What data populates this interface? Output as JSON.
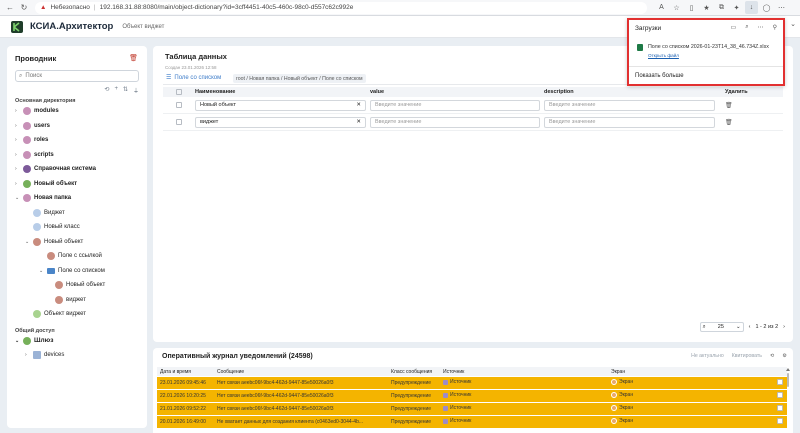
{
  "browser": {
    "security_label": "Небезопасно",
    "url": "192.168.31.88:8080/main/object-dictionary?id=3cff4451-40c5-460c-98c0-d557c62c992e"
  },
  "app": {
    "title": "КСИА.Архитектор",
    "subtitle": "Объект виджет",
    "accent": "#3d7cc9"
  },
  "explorer": {
    "title": "Проводник",
    "search_placeholder": "Поиск",
    "main_section": "Основная директория",
    "shared_section": "Общий доступ",
    "items": [
      {
        "label": "modules",
        "bold": true
      },
      {
        "label": "users",
        "bold": true
      },
      {
        "label": "roles",
        "bold": true
      },
      {
        "label": "scripts",
        "bold": true
      },
      {
        "label": "Справочная система",
        "bold": true
      },
      {
        "label": "Новый объект",
        "bold": true
      },
      {
        "label": "Новая папка",
        "bold": true
      }
    ],
    "children": {
      "vidzhet": "Виджет",
      "new_class": "Новый класс",
      "new_object": "Новый объект",
      "field_link": "Поле с ссылкой",
      "field_list": "Поле со списком",
      "new_object_2": "Новый объект",
      "vidzhet_2": "виджет",
      "object_widget": "Объект виджет"
    },
    "gateway": "Шлюз",
    "devices": "devices"
  },
  "table": {
    "title": "Таблица данных",
    "created": "Создан 23.01.2026 12:58",
    "tab": "Поле со списком",
    "breadcrumb": "root / Новая папка / Новый объект / Поле со списком",
    "columns": [
      "Наименование",
      "value",
      "description",
      "Удалить"
    ],
    "rows": [
      {
        "name": "Новый объект",
        "value_ph": "Введите значение",
        "desc_ph": "Введите значение"
      },
      {
        "name": "виджет",
        "value_ph": "Введите значение",
        "desc_ph": "Введите значение"
      }
    ],
    "page_size": "25",
    "page_info": "1 - 2 из 2"
  },
  "journal": {
    "title": "Оперативный журнал уведомлений (24598)",
    "not_relevant": "Не актуально",
    "quit": "Квитировать",
    "columns": [
      "Дата и время",
      "Сообщение",
      "Класс сообщения",
      "Источник",
      "Экран"
    ],
    "rows": [
      {
        "dt": "23.01.2026 09:45:46",
        "msg": "Нет связи aeebc06f-9bc4-462d-9447-85e50026a0f3",
        "cls": "Предупреждение",
        "src": "Источник",
        "scr": "Экран"
      },
      {
        "dt": "22.01.2026 10:20:25",
        "msg": "Нет связи aeebc06f-9bc4-462d-9447-85e50026a0f3",
        "cls": "Предупреждение",
        "src": "Источник",
        "scr": "Экран"
      },
      {
        "dt": "21.01.2026 09:52:22",
        "msg": "Нет связи aeebc06f-9bc4-462d-9447-85e50026a0f3",
        "cls": "Предупреждение",
        "src": "Источник",
        "scr": "Экран"
      },
      {
        "dt": "20.01.2026 16:49:00",
        "msg": "Не хватает данных для создания клиента (c0463ed0-3044-4b...",
        "cls": "Предупреждение",
        "src": "Источник",
        "scr": "Экран"
      }
    ]
  },
  "downloads": {
    "title": "Загрузки",
    "file": "Поле со списком 2026-01-23T14_38_46.734Z.xlsx",
    "open_file": "Открыть файл",
    "show_more": "Показать больше",
    "highlight_color": "#e23030"
  }
}
